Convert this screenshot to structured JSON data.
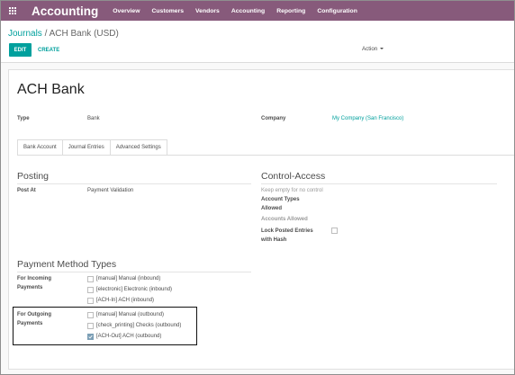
{
  "navbar": {
    "apps_icon": "apps-grid-icon",
    "brand": "Accounting",
    "menu": [
      "Overview",
      "Customers",
      "Vendors",
      "Accounting",
      "Reporting",
      "Configuration"
    ]
  },
  "breadcrumb": {
    "parent": "Journals",
    "separator": "/",
    "current": "ACH Bank (USD)"
  },
  "toolbar": {
    "edit_label": "EDIT",
    "create_label": "CREATE",
    "action_label": "Action"
  },
  "form": {
    "title": "ACH Bank",
    "type_label": "Type",
    "type_value": "Bank",
    "company_label": "Company",
    "company_value": "My Company (San Francisco)",
    "tabs": [
      "Bank Account",
      "Journal Entries",
      "Advanced Settings"
    ],
    "active_tab": "Advanced Settings",
    "posting": {
      "title": "Posting",
      "post_at_label": "Post At",
      "post_at_value": "Payment Validation"
    },
    "control_access": {
      "title": "Control-Access",
      "hint": "Keep empty for no control",
      "account_types_label": "Account Types Allowed",
      "accounts_allowed_label": "Accounts Allowed",
      "lock_posted_label": "Lock Posted Entries with Hash",
      "lock_posted_checked": false
    },
    "payment_methods": {
      "title": "Payment Method Types",
      "incoming_label": "For Incoming Payments",
      "incoming": [
        {
          "label": "[manual] Manual (inbound)",
          "checked": false
        },
        {
          "label": "[electronic] Electronic (inbound)",
          "checked": false
        },
        {
          "label": "[ACH-In] ACH (inbound)",
          "checked": false
        }
      ],
      "outgoing_label": "For Outgoing Payments",
      "outgoing": [
        {
          "label": "[manual] Manual (outbound)",
          "checked": false
        },
        {
          "label": "[check_printing] Checks (outbound)",
          "checked": false
        },
        {
          "label": "[ACH-Out] ACH (outbound)",
          "checked": true
        }
      ]
    }
  },
  "colors": {
    "navbar": "#875a7b",
    "accent": "#00A09D",
    "checked": "#7c9fb6"
  }
}
